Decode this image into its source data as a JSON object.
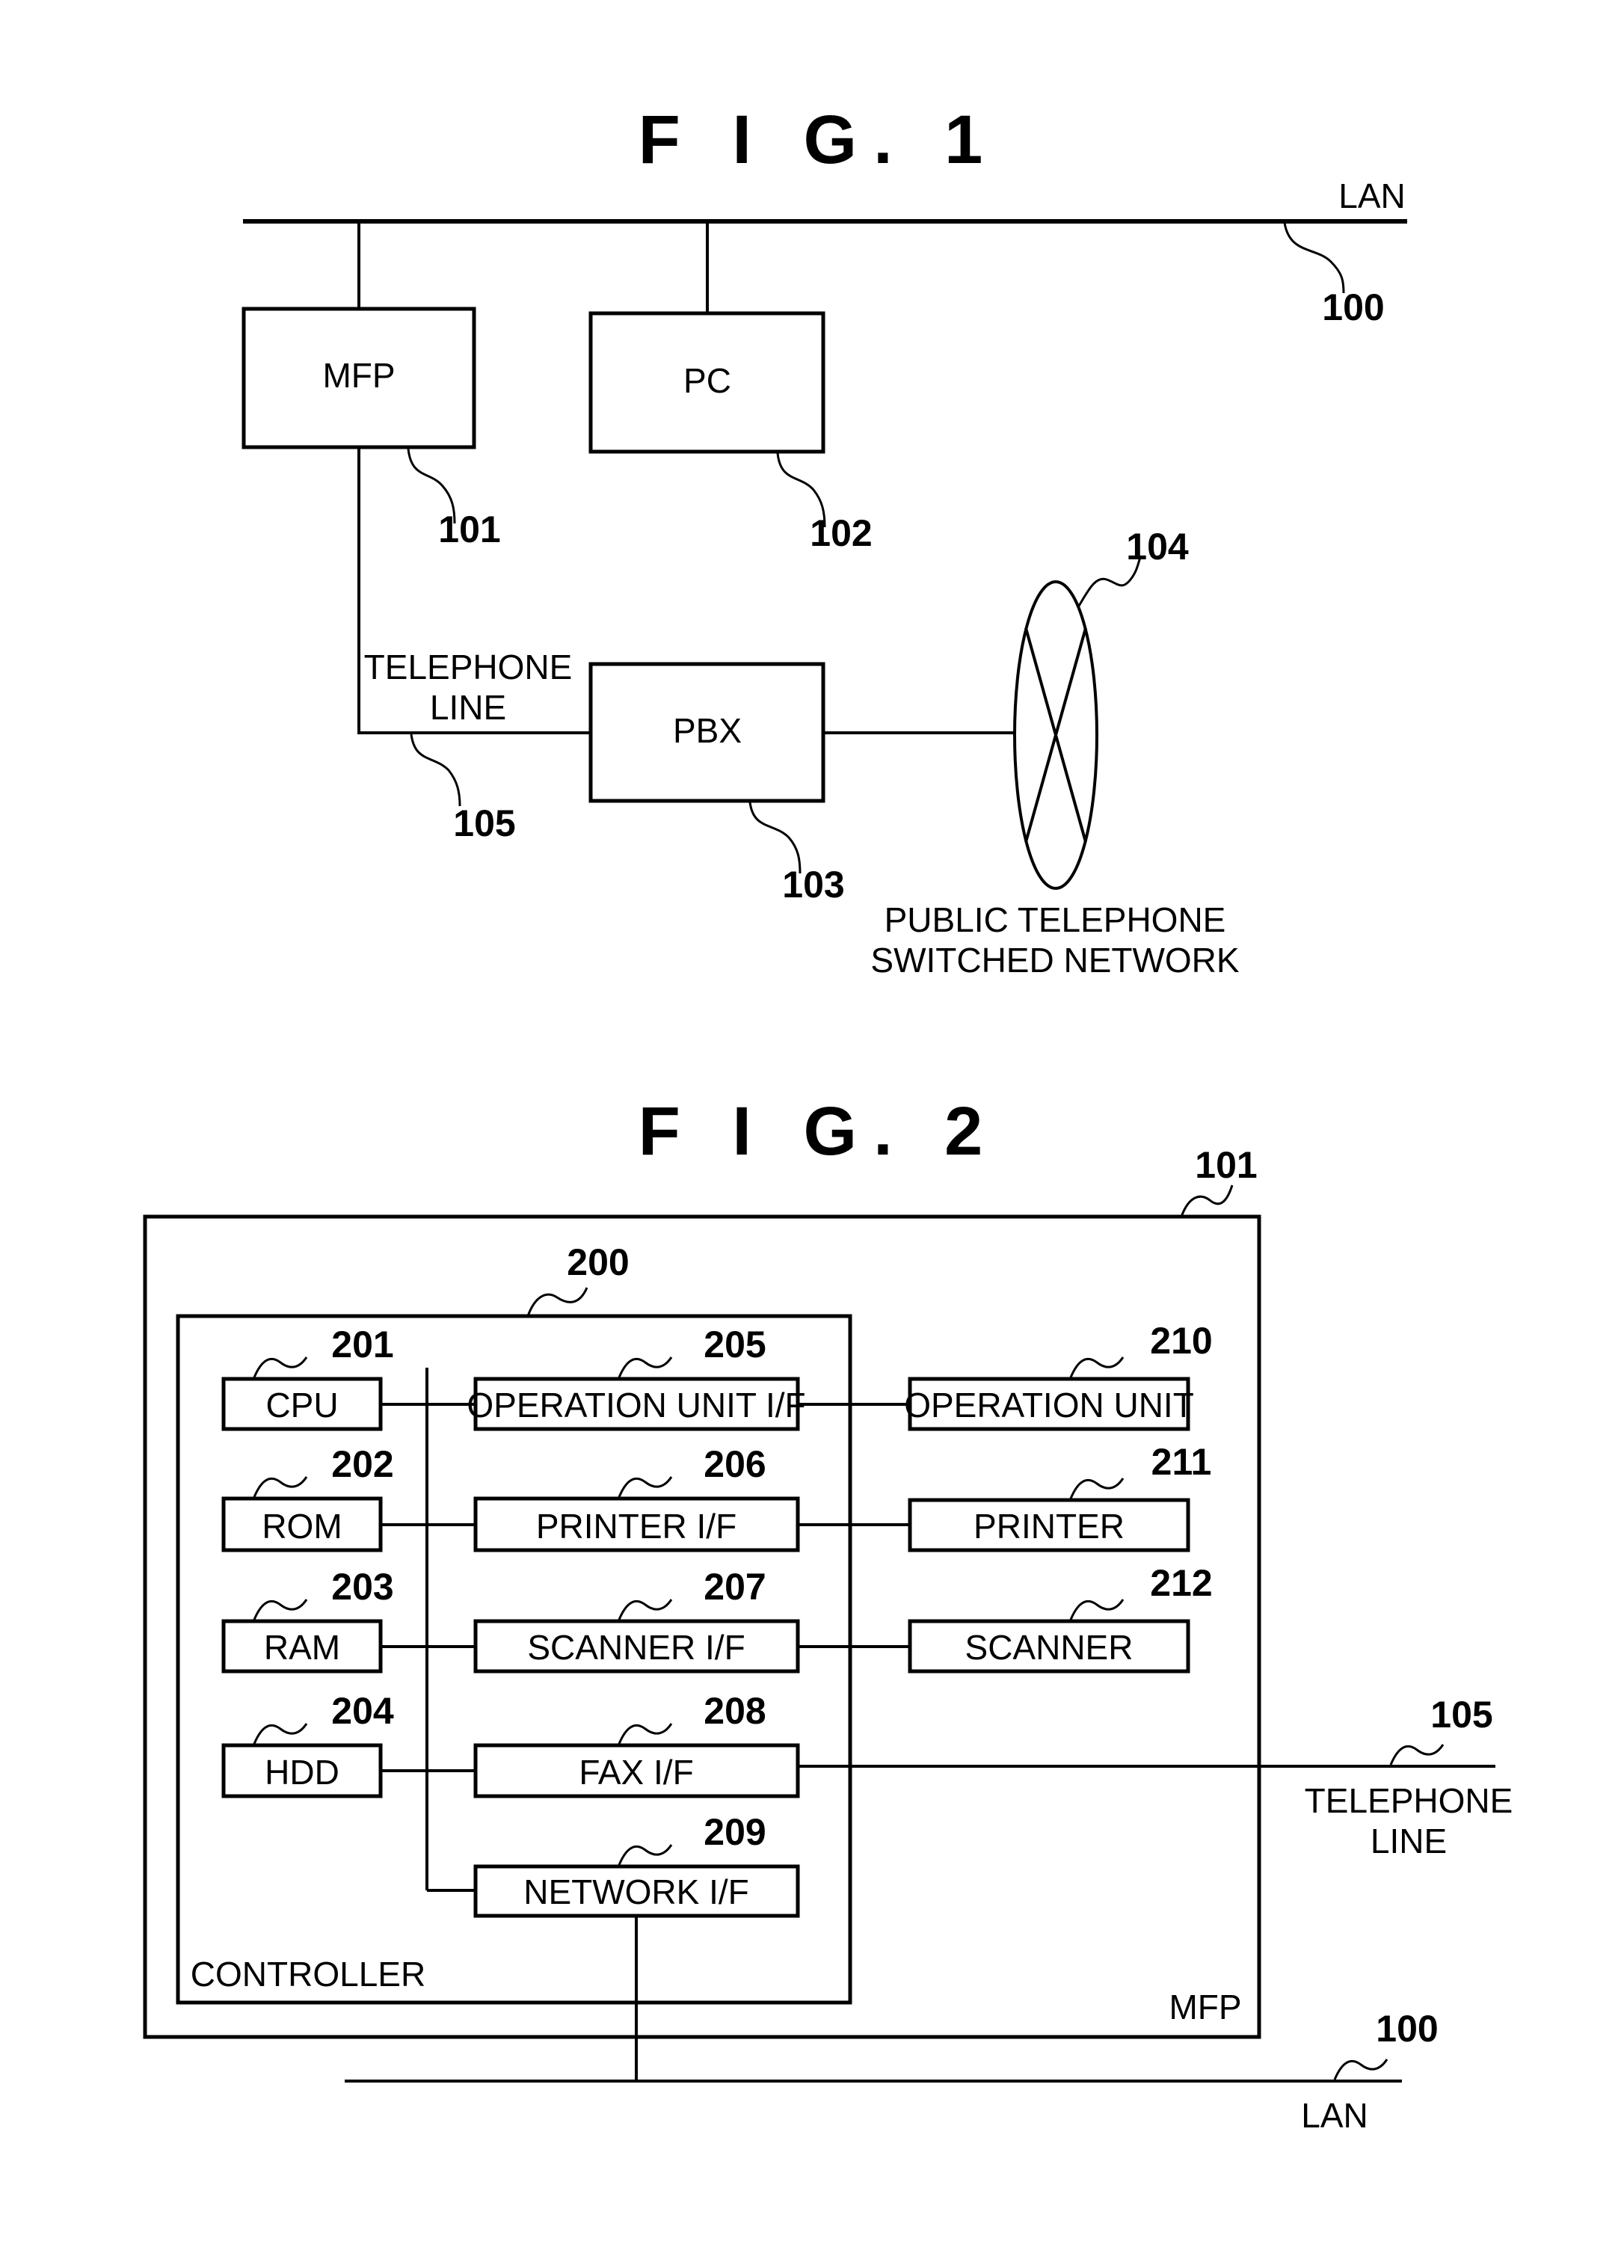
{
  "fig1": {
    "title": "F I G. 1",
    "lan_label": "LAN",
    "lan_ref": "100",
    "mfp": {
      "label": "MFP",
      "ref": "101"
    },
    "pc": {
      "label": "PC",
      "ref": "102"
    },
    "pbx": {
      "label": "PBX",
      "ref": "103"
    },
    "pstn": {
      "ref": "104",
      "label_line1": "PUBLIC TELEPHONE",
      "label_line2": "SWITCHED NETWORK"
    },
    "telephone_line": {
      "label_line1": "TELEPHONE",
      "label_line2": "LINE",
      "ref": "105"
    }
  },
  "fig2": {
    "title": "F I G. 2",
    "mfp": {
      "label": "MFP",
      "ref": "101"
    },
    "controller": {
      "label": "CONTROLLER",
      "ref": "200"
    },
    "cpu": {
      "label": "CPU",
      "ref": "201"
    },
    "rom": {
      "label": "ROM",
      "ref": "202"
    },
    "ram": {
      "label": "RAM",
      "ref": "203"
    },
    "hdd": {
      "label": "HDD",
      "ref": "204"
    },
    "op_if": {
      "label": "OPERATION UNIT I/F",
      "ref": "205"
    },
    "printer_if": {
      "label": "PRINTER I/F",
      "ref": "206"
    },
    "scanner_if": {
      "label": "SCANNER I/F",
      "ref": "207"
    },
    "fax_if": {
      "label": "FAX I/F",
      "ref": "208"
    },
    "network_if": {
      "label": "NETWORK I/F",
      "ref": "209"
    },
    "op_unit": {
      "label": "OPERATION UNIT",
      "ref": "210"
    },
    "printer": {
      "label": "PRINTER",
      "ref": "211"
    },
    "scanner": {
      "label": "SCANNER",
      "ref": "212"
    },
    "telephone_line": {
      "label_line1": "TELEPHONE",
      "label_line2": "LINE",
      "ref": "105"
    },
    "lan": {
      "label": "LAN",
      "ref": "100"
    }
  }
}
